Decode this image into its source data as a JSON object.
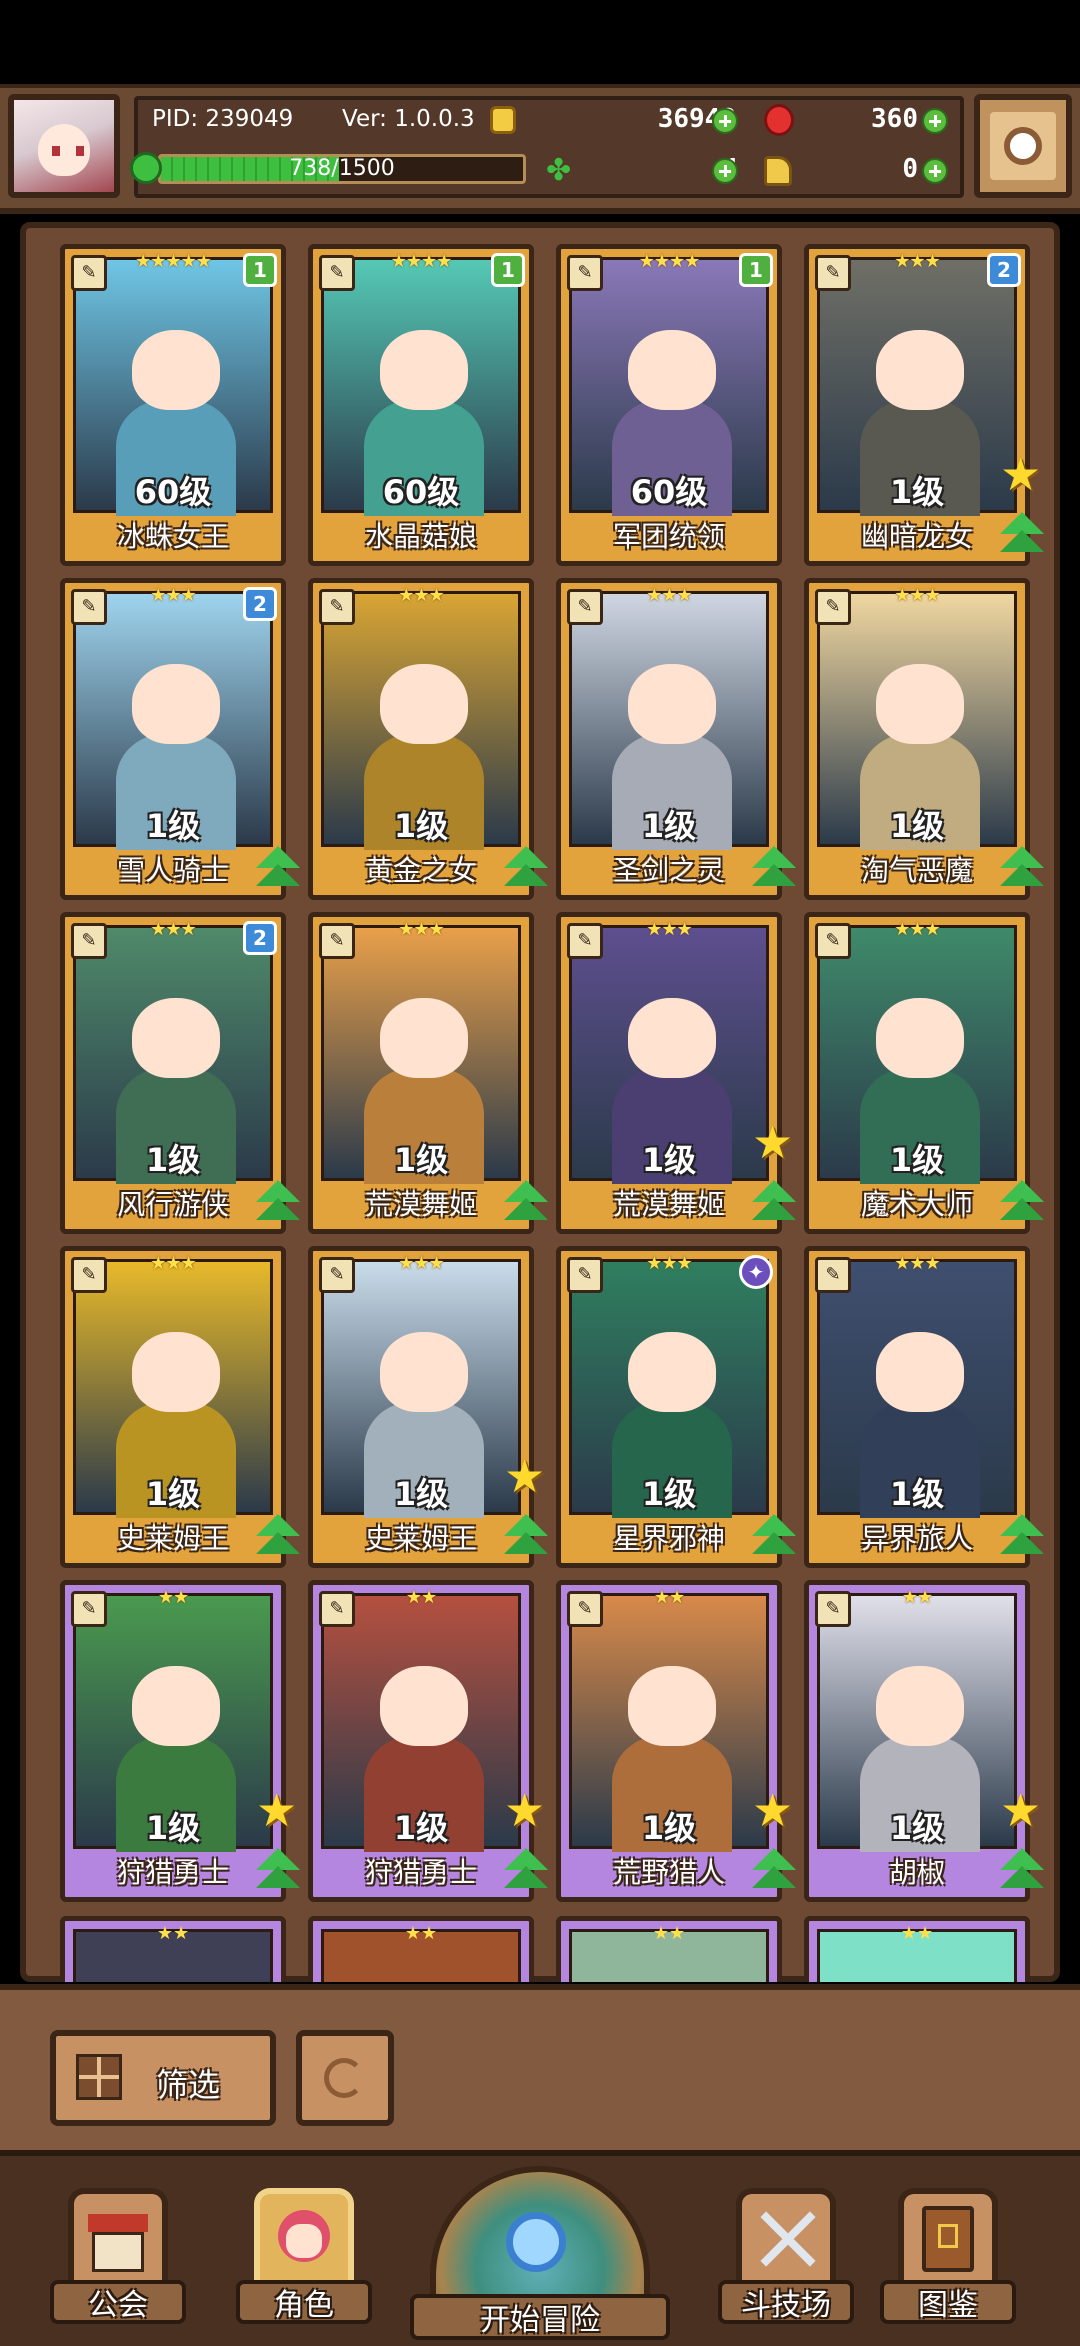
{
  "header": {
    "pid": "PID: 239049",
    "version": "Ver: 1.0.0.3",
    "gold": "36948",
    "gems": "360",
    "clover": "4",
    "key": "0",
    "xp_text": "738/1500",
    "xp_fraction": 0.492
  },
  "cards": [
    {
      "name": "冰蛛女王",
      "level": "60级",
      "stars": "★★★★★",
      "badge": "1",
      "badge_color": "green",
      "rarity": "r3",
      "hue": "#6fc6e6",
      "upgrade": false,
      "gold_star": false
    },
    {
      "name": "水晶菇娘",
      "level": "60级",
      "stars": "★★★★",
      "badge": "1",
      "badge_color": "green",
      "rarity": "r3",
      "hue": "#55c9b5",
      "upgrade": false,
      "gold_star": false
    },
    {
      "name": "军团统领",
      "level": "60级",
      "stars": "★★★★",
      "badge": "1",
      "badge_color": "green",
      "rarity": "r3",
      "hue": "#8a78b8",
      "upgrade": false,
      "gold_star": false
    },
    {
      "name": "幽暗龙女",
      "level": "1级",
      "stars": "★★★",
      "badge": "2",
      "badge_color": "blue",
      "rarity": "r3",
      "hue": "#6f6f66",
      "upgrade": true,
      "gold_star": true
    },
    {
      "name": "雪人骑士",
      "level": "1级",
      "stars": "★★★",
      "badge": "2",
      "badge_color": "blue",
      "rarity": "r3",
      "hue": "#9fd4ee",
      "upgrade": true,
      "gold_star": false
    },
    {
      "name": "黄金之女",
      "level": "1级",
      "stars": "★★★",
      "badge": "",
      "badge_color": "",
      "rarity": "r3",
      "hue": "#d9a534",
      "upgrade": true,
      "gold_star": false
    },
    {
      "name": "圣剑之灵",
      "level": "1级",
      "stars": "★★★",
      "badge": "",
      "badge_color": "",
      "rarity": "r3",
      "hue": "#cfd6e2",
      "upgrade": true,
      "gold_star": false
    },
    {
      "name": "淘气恶魔",
      "level": "1级",
      "stars": "★★★",
      "badge": "",
      "badge_color": "",
      "rarity": "r3",
      "hue": "#f0d7a0",
      "upgrade": true,
      "gold_star": false
    },
    {
      "name": "风行游侠",
      "level": "1级",
      "stars": "★★★",
      "badge": "2",
      "badge_color": "blue",
      "rarity": "r3",
      "hue": "#4f8a6a",
      "upgrade": true,
      "gold_star": false
    },
    {
      "name": "荒漠舞姬",
      "level": "1级",
      "stars": "★★★",
      "badge": "",
      "badge_color": "",
      "rarity": "r3",
      "hue": "#e9a04a",
      "upgrade": true,
      "gold_star": false
    },
    {
      "name": "荒漠舞姬",
      "level": "1级",
      "stars": "★★★",
      "badge": "",
      "badge_color": "",
      "rarity": "r3",
      "hue": "#5e4f8f",
      "upgrade": true,
      "gold_star": true
    },
    {
      "name": "魔术大师",
      "level": "1级",
      "stars": "★★★",
      "badge": "",
      "badge_color": "",
      "rarity": "r3",
      "hue": "#3f8a6a",
      "upgrade": true,
      "gold_star": false
    },
    {
      "name": "史莱姆王",
      "level": "1级",
      "stars": "★★★",
      "badge": "",
      "badge_color": "",
      "rarity": "r3",
      "hue": "#e8b92a",
      "upgrade": true,
      "gold_star": false
    },
    {
      "name": "史莱姆王",
      "level": "1级",
      "stars": "★★★",
      "badge": "",
      "badge_color": "",
      "rarity": "r3",
      "hue": "#c9dcea",
      "upgrade": true,
      "gold_star": true
    },
    {
      "name": "星界邪神",
      "level": "1级",
      "stars": "★★★",
      "badge": "",
      "badge_color": "purple",
      "rarity": "r3",
      "hue": "#2f7f5f",
      "upgrade": true,
      "gold_star": false
    },
    {
      "name": "异界旅人",
      "level": "1级",
      "stars": "★★★",
      "badge": "",
      "badge_color": "",
      "rarity": "r3",
      "hue": "#3f4f6f",
      "upgrade": true,
      "gold_star": false
    },
    {
      "name": "狩猎勇士",
      "level": "1级",
      "stars": "★★",
      "badge": "",
      "badge_color": "",
      "rarity": "r2",
      "hue": "#4a9a4f",
      "upgrade": true,
      "gold_star": true
    },
    {
      "name": "狩猎勇士",
      "level": "1级",
      "stars": "★★",
      "badge": "",
      "badge_color": "",
      "rarity": "r2",
      "hue": "#b5503f",
      "upgrade": true,
      "gold_star": true
    },
    {
      "name": "荒野猎人",
      "level": "1级",
      "stars": "★★",
      "badge": "",
      "badge_color": "",
      "rarity": "r2",
      "hue": "#d88a4a",
      "upgrade": true,
      "gold_star": true
    },
    {
      "name": "胡椒",
      "level": "1级",
      "stars": "★★",
      "badge": "",
      "badge_color": "",
      "rarity": "r2",
      "hue": "#e0e0ea",
      "upgrade": true,
      "gold_star": true
    }
  ],
  "partial_cards": [
    {
      "stars": "★★",
      "hue": "#3f3f55"
    },
    {
      "stars": "★★",
      "hue": "#a0522d"
    },
    {
      "stars": "★★",
      "hue": "#8fb59a"
    },
    {
      "stars": "★★",
      "hue": "#7fe0c8"
    }
  ],
  "filter": {
    "label": "筛选"
  },
  "tabs": {
    "guild": "公会",
    "roles": "角色",
    "adventure": "开始冒险",
    "arena": "斗技场",
    "codex": "图鉴"
  },
  "colors": {
    "gold_rarity": "#e2a23c",
    "purple_rarity": "#b486e0",
    "upgrade_green": "#3fbf4f"
  }
}
